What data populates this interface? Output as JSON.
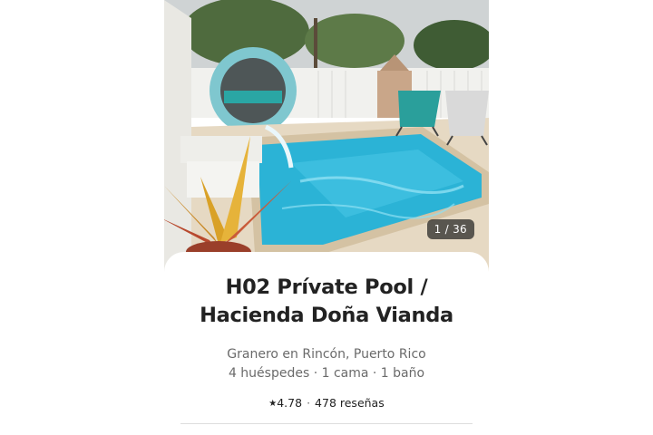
{
  "listing": {
    "photo_counter": "1 / 36",
    "title_line1": "H02 Prívate Pool /",
    "title_line2": "Hacienda Doña Vianda",
    "location": "Granero en Rincón, Puerto Rico",
    "details": "4 huéspedes · 1 cama · 1 baño",
    "rating": "4.78",
    "rating_separator": "·",
    "reviews": "478 reseñas",
    "star_icon": "star-icon"
  },
  "colors": {
    "text_primary": "#222222",
    "text_secondary": "#6a6a6a",
    "pool": "#2bb3d6",
    "divider": "#dddddd"
  }
}
